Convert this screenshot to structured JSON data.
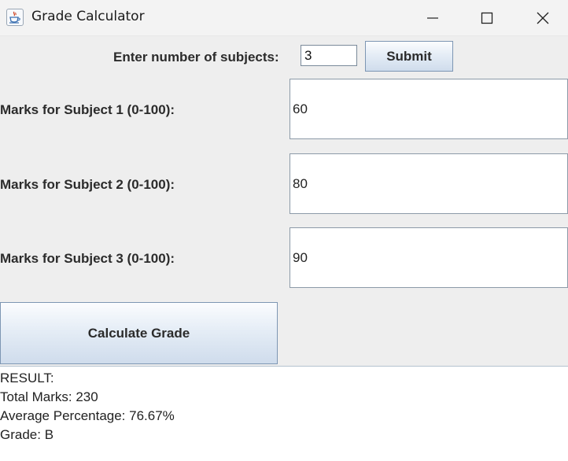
{
  "window": {
    "title": "Grade Calculator",
    "icon": "java-coffee-icon",
    "controls": [
      "minimize-icon",
      "maximize-icon",
      "close-icon"
    ]
  },
  "subjects_prompt": {
    "label": "Enter number of subjects:",
    "value": "3",
    "submit_label": "Submit"
  },
  "subjects": [
    {
      "label": "Marks for Subject 1 (0-100):",
      "value": "60"
    },
    {
      "label": "Marks for Subject 2 (0-100):",
      "value": "80"
    },
    {
      "label": "Marks for Subject 3 (0-100):",
      "value": "90"
    }
  ],
  "calculate_label": "Calculate Grade",
  "result": {
    "heading": "RESULT:",
    "total": "Total Marks: 230",
    "average": "Average Percentage: 76.67%",
    "grade": "Grade: B"
  },
  "colors": {
    "window_bg": "#eeeeee",
    "titlebar_bg": "#f3f3f3",
    "button_border": "#7d96b3",
    "result_bg": "#ffffff"
  }
}
